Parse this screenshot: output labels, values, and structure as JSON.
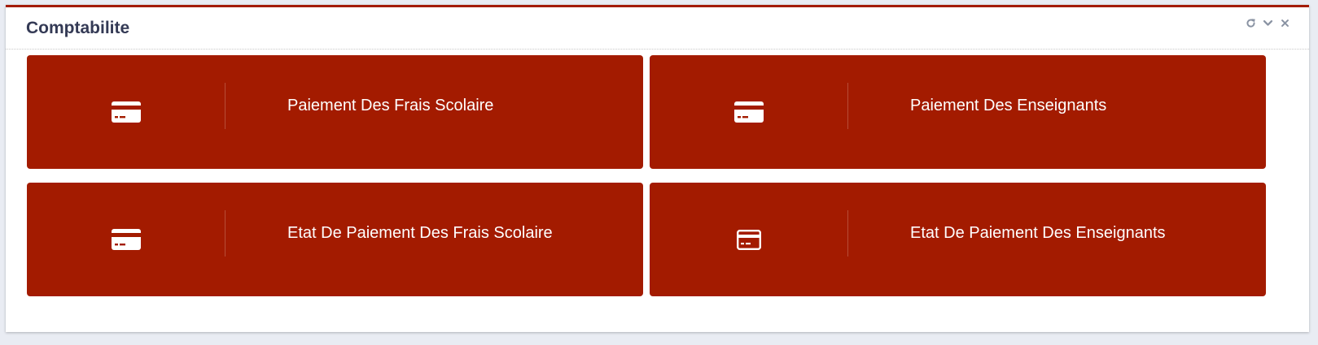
{
  "panel": {
    "title": "Comptabilite",
    "tools": [
      {
        "icon": "refresh-icon"
      },
      {
        "icon": "chevron-down-icon"
      },
      {
        "icon": "close-icon"
      }
    ]
  },
  "tiles": [
    {
      "label": "Paiement Des Frais Scolaire",
      "icon": "credit-card-icon"
    },
    {
      "label": "Paiement Des Enseignants",
      "icon": "credit-card-icon"
    },
    {
      "label": "Etat De Paiement Des Frais Scolaire",
      "icon": "credit-card-icon"
    },
    {
      "label": "Etat De Paiement Des Enseignants",
      "icon": "credit-card-outline-icon"
    }
  ],
  "colors": {
    "accent": "#a31b00",
    "title": "#343a55",
    "background": "#e9ecf3"
  }
}
